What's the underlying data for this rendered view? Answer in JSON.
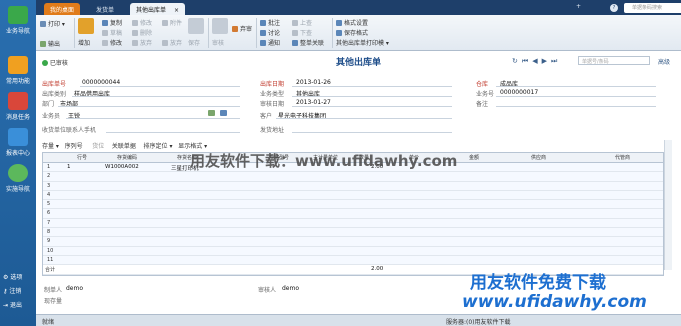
{
  "left_nav": {
    "items": [
      {
        "label": "业务导航",
        "icon": "grid-plus-icon"
      },
      {
        "label": "常用功能",
        "icon": "star-icon"
      },
      {
        "label": "消息任务",
        "icon": "calendar-icon"
      },
      {
        "label": "报表中心",
        "icon": "report-icon"
      },
      {
        "label": "实施导航",
        "icon": "gear-icon"
      }
    ],
    "bottom": [
      {
        "label": "选项",
        "icon": "settings-icon"
      },
      {
        "label": "注销",
        "icon": "key-icon"
      },
      {
        "label": "退出",
        "icon": "exit-icon"
      }
    ]
  },
  "tabs": [
    {
      "label": "我的桌面"
    },
    {
      "label": "发货单"
    },
    {
      "label": "其他出库单",
      "close": "×"
    }
  ],
  "tabbar": {
    "add": "+",
    "help": "?",
    "search_placeholder": "单据条码搜索"
  },
  "ribbon": {
    "print": "打印",
    "output": "输出",
    "add": "增加",
    "copy": "复制",
    "draft": "草稿",
    "modify": "修改",
    "delete": "删除",
    "abandon": "放弃",
    "attach": "附件",
    "save": "保存",
    "audit": "审核",
    "revoke": "弃审",
    "batch": "批注",
    "discuss": "讨论",
    "notify": "通知",
    "up": "上查",
    "down": "下查",
    "link": "整单关联",
    "format_settings": "格式设置",
    "save_format": "保存格式",
    "print_template": "其他出库单打印模"
  },
  "bill": {
    "status": "已审核",
    "title": "其他出库单",
    "search_placeholder": "单据号/条码",
    "help": "高级"
  },
  "header": {
    "bill_no_label": "出库单号",
    "bill_no": "0000000044",
    "out_date_label": "出库日期",
    "out_date": "2013-01-26",
    "warehouse_label": "仓库",
    "warehouse": "成品库",
    "out_type_label": "出库类别",
    "out_type": "样品借用出库",
    "biz_type_label": "业务类型",
    "biz_type": "其他出库",
    "biz_no_label": "业务号",
    "biz_no": "0000000017",
    "dept_label": "部门",
    "dept": "市场部",
    "audit_date_label": "审核日期",
    "audit_date": "2013-01-27",
    "remark_label": "备注",
    "staff_label": "业务员",
    "staff": "王锐",
    "customer_label": "客户",
    "customer": "星光电子科技集团",
    "contact_label": "收货单位联系人手机",
    "ship_addr_label": "发货地址"
  },
  "grid_toolbar": [
    "存量",
    "序列号",
    "货位",
    "关联单据",
    "排序定位",
    "显示格式"
  ],
  "grid": {
    "columns": [
      "",
      "行号",
      "存货编码",
      "存货名称",
      "",
      "规格型号",
      "主计量单位",
      "数量",
      "单价",
      "金额",
      "供应商",
      "代管商"
    ],
    "rows": [
      {
        "row": "1",
        "line": "1",
        "code": "W1000A002",
        "name": "三星打印机",
        "qty": "2.00"
      },
      {
        "row": "2"
      },
      {
        "row": "3"
      },
      {
        "row": "4"
      },
      {
        "row": "5"
      },
      {
        "row": "6"
      },
      {
        "row": "7"
      },
      {
        "row": "8"
      },
      {
        "row": "9"
      },
      {
        "row": "10"
      },
      {
        "row": "11"
      }
    ],
    "total_label": "合计",
    "total_qty": "2.00"
  },
  "footer": {
    "maker_label": "制单人",
    "maker": "demo",
    "auditor_label": "审核人",
    "auditor": "demo",
    "current_stock_label": "现存量"
  },
  "statusbar": {
    "left": "就绪",
    "right": "服务器:(0)用友软件下载"
  },
  "watermark": {
    "center": "用友软件下载：www.ufidawhy.com",
    "bottom_line1": "用友软件免费下载",
    "bottom_line2": "www.ufidawhy.com"
  }
}
